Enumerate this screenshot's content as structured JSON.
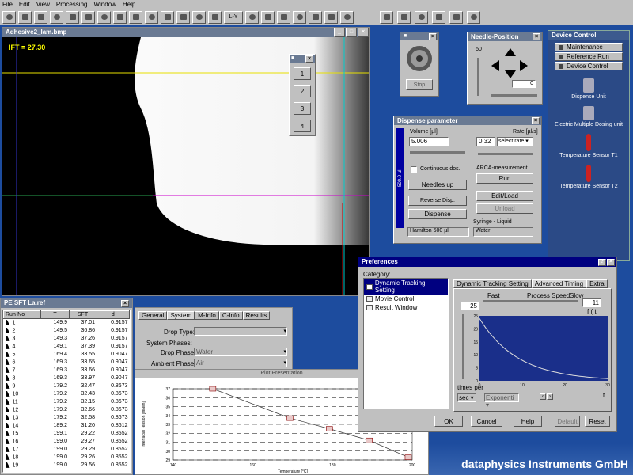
{
  "menu": [
    "File",
    "Edit",
    "View",
    "Processing",
    "Window",
    "Help"
  ],
  "toolbar": {
    "ly_label": "L-Y"
  },
  "image_window": {
    "title": "Adhesive2_lam.bmp",
    "ift_label": "IFT = 27.30"
  },
  "mini_panel": {
    "buttons": [
      "1",
      "2",
      "3",
      "4"
    ]
  },
  "stop_panel": {
    "stop_label": "Stop"
  },
  "needle": {
    "title": "Needle-Position",
    "value_top": "50",
    "value_right": "0"
  },
  "device_control": {
    "title": "Device Control",
    "buttons": [
      "Maintenance",
      "Reference Run",
      "Device Control"
    ],
    "devices": [
      "Dispense Unit",
      "Electric Multiple Dosing unit",
      "Temperature Sensor T1",
      "Temperature Sensor T2"
    ]
  },
  "dispense": {
    "title": "Dispense parameter",
    "volume_label": "Volume [µl]",
    "volume_value": "5.006",
    "rate_label": "Rate [µl/s]",
    "rate_value": "0.32",
    "rate_select": "select rate",
    "continuous": "Continuous dos.",
    "needles_up": "Needles up",
    "reverse": "Reverse Disp.",
    "dispense": "Dispense",
    "syringe_bar": "500.0 µl",
    "arca_label": "ARCA-measurement",
    "run": "Run",
    "edit_load": "Edit/Load",
    "unload": "Unload",
    "syringe_liquid": "Syringe - Liquid",
    "syringe": "Hamilton 500 µl",
    "liquid": "Water"
  },
  "results": {
    "title": "PE SFT La.ref",
    "headers": [
      "Run-No",
      "T",
      "SFT",
      "d"
    ],
    "rows": [
      [
        "1",
        "149.9",
        "37.01",
        "0.9157"
      ],
      [
        "2",
        "149.5",
        "36.86",
        "0.9157"
      ],
      [
        "3",
        "149.3",
        "37.26",
        "0.9157"
      ],
      [
        "4",
        "149.1",
        "37.39",
        "0.9157"
      ],
      [
        "5",
        "169.4",
        "33.55",
        "0.9047"
      ],
      [
        "6",
        "169.3",
        "33.65",
        "0.9047"
      ],
      [
        "7",
        "169.3",
        "33.66",
        "0.9047"
      ],
      [
        "8",
        "169.3",
        "33.97",
        "0.9047"
      ],
      [
        "9",
        "179.2",
        "32.47",
        "0.8673"
      ],
      [
        "10",
        "179.2",
        "32.43",
        "0.8673"
      ],
      [
        "11",
        "179.2",
        "32.15",
        "0.8673"
      ],
      [
        "12",
        "179.2",
        "32.66",
        "0.8673"
      ],
      [
        "13",
        "179.2",
        "32.58",
        "0.8673"
      ],
      [
        "14",
        "189.2",
        "31.20",
        "0.8612"
      ],
      [
        "15",
        "199.1",
        "29.22",
        "0.8552"
      ],
      [
        "16",
        "199.0",
        "29.27",
        "0.8552"
      ],
      [
        "17",
        "199.0",
        "29.29",
        "0.8552"
      ],
      [
        "18",
        "199.0",
        "29.26",
        "0.8552"
      ],
      [
        "19",
        "199.0",
        "29.56",
        "0.8552"
      ]
    ]
  },
  "settings": {
    "tabs": [
      "General",
      "System",
      "M-Info",
      "C-Info",
      "Results"
    ],
    "drop_type": "Drop Type:",
    "phases": "System Phases:",
    "drop_phase": "Drop Phase:",
    "drop_phase_value": "Water",
    "ambient_phase": "Ambient Phase:",
    "ambient_value": "Air"
  },
  "plot": {
    "title": "Plot Presentation",
    "ylabel": "Interfacial Tension [mN/m]",
    "xlabel": "Temperature [°C]"
  },
  "chart_data": {
    "type": "scatter",
    "title": "Plot Presentation",
    "xlabel": "Temperature [°C]",
    "ylabel": "Interfacial Tension [mN/m]",
    "xlim": [
      140,
      200
    ],
    "ylim": [
      29,
      37
    ],
    "x_ticks": [
      "140",
      "160",
      "180",
      "200"
    ],
    "y_ticks": [
      "37",
      "36",
      "35",
      "34",
      "33",
      "32",
      "31",
      "30",
      "29"
    ],
    "points": [
      [
        149.9,
        37.0
      ],
      [
        169.3,
        33.7
      ],
      [
        179.2,
        32.5
      ],
      [
        189.2,
        31.2
      ],
      [
        199.0,
        29.3
      ]
    ]
  },
  "prefs": {
    "title": "Preferences",
    "category": "Category:",
    "tree": [
      "Dynamic Tracking Setting",
      "Movie Control",
      "Result Window"
    ],
    "tabs": [
      "Dynamic Tracking Setting",
      "Advanced Timing",
      "Extra"
    ],
    "fast": "Fast",
    "speed": "Process Speed",
    "slow": "Slow",
    "left_val": "25",
    "right_val": "11",
    "ft": "f ( t",
    "times_per": "times per",
    "unit_select": "sec",
    "curve_select": "Exponenti",
    "t_label": "t",
    "y_ticks": [
      "25",
      "20",
      "15",
      "10",
      "5",
      "0"
    ],
    "x_ticks": [
      "0",
      "10",
      "20",
      "30"
    ],
    "ok": "OK",
    "cancel": "Cancel",
    "help": "Help",
    "default": "Default",
    "reset": "Reset"
  },
  "brand": "dataphysics Instruments GmbH",
  "colors": {
    "desktop": "#1d4c9e",
    "window_title": "#6a7a93",
    "accent": "#0000a0"
  }
}
